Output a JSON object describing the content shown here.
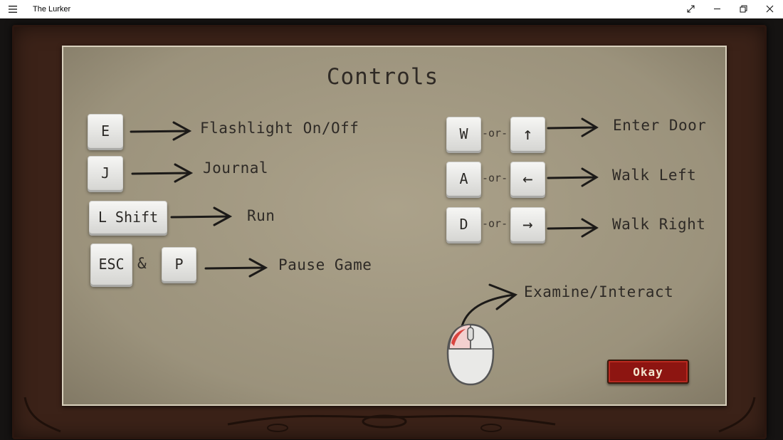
{
  "window": {
    "title": "The Lurker",
    "menu_icon": "hamburger-icon",
    "buttons": [
      "fullscreen-icon",
      "minimize-icon",
      "restore-icon",
      "close-icon"
    ]
  },
  "controls": {
    "title": "Controls",
    "left": [
      {
        "keys": [
          "E"
        ],
        "action": "Flashlight On/Off"
      },
      {
        "keys": [
          "J"
        ],
        "action": "Journal"
      },
      {
        "keys": [
          "L Shift"
        ],
        "action": "Run"
      },
      {
        "keys": [
          "ESC",
          "P"
        ],
        "joiner": "&",
        "action": "Pause Game"
      }
    ],
    "right": [
      {
        "key": "W",
        "alt": "↑",
        "joiner": "-or-",
        "action": "Enter Door"
      },
      {
        "key": "A",
        "alt": "←",
        "joiner": "-or-",
        "action": "Walk Left"
      },
      {
        "key": "D",
        "alt": "→",
        "joiner": "-or-",
        "action": "Walk Right"
      }
    ],
    "mouse": {
      "icon": "mouse-icon",
      "action": "Examine/Interact"
    },
    "okay_label": "Okay"
  },
  "colors": {
    "paper": "#a19881",
    "frame": "#3b2218",
    "okay_button": "#8d1511"
  }
}
